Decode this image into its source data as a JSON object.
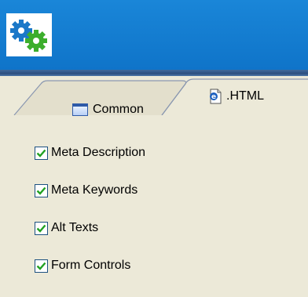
{
  "header": {
    "logo_icon": "gears-icon",
    "colors": {
      "header_bg": "#1a86d8",
      "gear_blue": "#1b78c8",
      "gear_green": "#3cae2c"
    }
  },
  "tabs": [
    {
      "label": "Common",
      "icon": "window-icon",
      "active": false
    },
    {
      "label": ".HTML",
      "icon": "html-document-icon",
      "active": true
    }
  ],
  "options": [
    {
      "label": "Meta Description",
      "checked": true
    },
    {
      "label": "Meta Keywords",
      "checked": true
    },
    {
      "label": "Alt Texts",
      "checked": true
    },
    {
      "label": "Form Controls",
      "checked": true
    }
  ]
}
